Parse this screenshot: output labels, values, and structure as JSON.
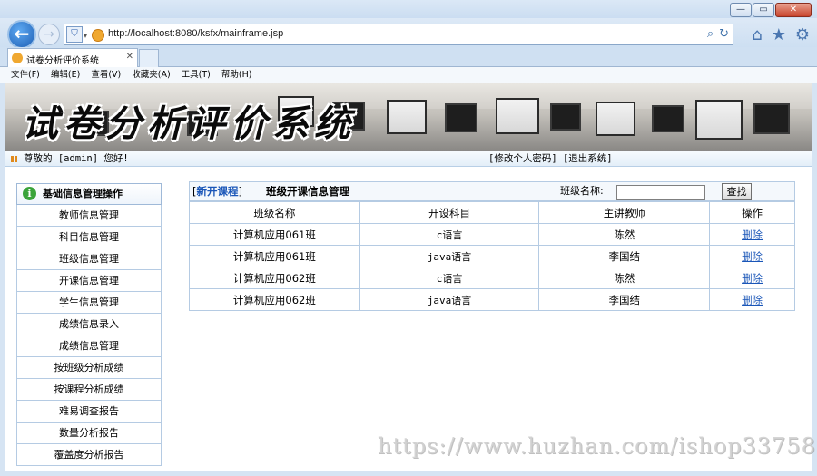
{
  "browser": {
    "url": "http://localhost:8080/ksfx/mainframe.jsp",
    "tab_title": "试卷分析评价系统",
    "menu": [
      "文件(F)",
      "编辑(E)",
      "查看(V)",
      "收藏夹(A)",
      "工具(T)",
      "帮助(H)"
    ]
  },
  "banner": {
    "title": "试卷分析评价系统"
  },
  "userbar": {
    "greeting": "尊敬的 [admin] 您好!",
    "links": "[修改个人密码] [退出系统]"
  },
  "sidebar": {
    "heading": "基础信息管理操作",
    "items": [
      {
        "label": "教师信息管理"
      },
      {
        "label": "科目信息管理"
      },
      {
        "label": "班级信息管理"
      },
      {
        "label": "开课信息管理"
      },
      {
        "label": "学生信息管理"
      },
      {
        "label": "成绩信息录入"
      },
      {
        "label": "成绩信息管理"
      },
      {
        "label": "按班级分析成绩"
      },
      {
        "label": "按课程分析成绩"
      },
      {
        "label": "难易调查报告"
      },
      {
        "label": "数量分析报告"
      },
      {
        "label": "覆盖度分析报告"
      }
    ]
  },
  "main": {
    "new_link": "新开课程",
    "title": "班级开课信息管理",
    "search_label": "班级名称:",
    "search_value": "",
    "search_button": "查找",
    "columns": [
      "班级名称",
      "开设科目",
      "主讲教师",
      "操作"
    ],
    "rows": [
      {
        "class": "计算机应用061班",
        "subject": "c语言",
        "teacher": "陈然",
        "action": "删除"
      },
      {
        "class": "计算机应用061班",
        "subject": "java语言",
        "teacher": "李国结",
        "action": "删除"
      },
      {
        "class": "计算机应用062班",
        "subject": "c语言",
        "teacher": "陈然",
        "action": "删除"
      },
      {
        "class": "计算机应用062班",
        "subject": "java语言",
        "teacher": "李国结",
        "action": "删除"
      }
    ]
  },
  "watermark": "https://www.huzhan.com/ishop33758",
  "icons": {
    "back": "arrow-left-icon",
    "forward": "arrow-right-icon",
    "home": "home-icon",
    "favorites": "star-icon",
    "settings": "gear-icon",
    "info": "info-icon"
  }
}
